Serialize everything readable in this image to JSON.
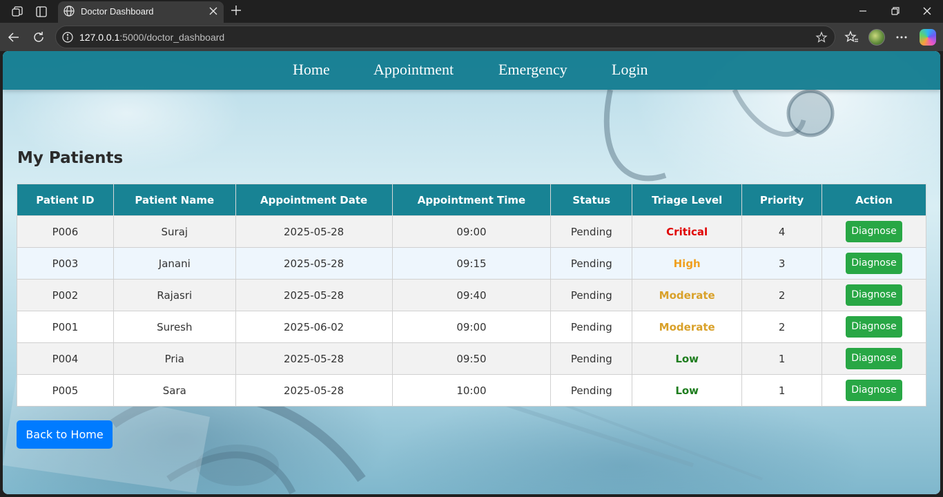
{
  "browser": {
    "tab_title": "Doctor Dashboard",
    "url_host": "127.0.0.1",
    "url_rest": ":5000/doctor_dashboard"
  },
  "nav": {
    "home": "Home",
    "appointment": "Appointment",
    "emergency": "Emergency",
    "login": "Login"
  },
  "page": {
    "title": "My Patients",
    "back_label": "Back to Home"
  },
  "colors": {
    "navbar": "#188394",
    "critical": "#e00000",
    "high": "#f0a020",
    "moderate": "#d9a12a",
    "low": "#1e7d1e",
    "diagnose_button": "#28a745",
    "back_button": "#007bff"
  },
  "table": {
    "headers": [
      "Patient ID",
      "Patient Name",
      "Appointment Date",
      "Appointment Time",
      "Status",
      "Triage Level",
      "Priority",
      "Action"
    ],
    "rows": [
      {
        "id": "P006",
        "name": "Suraj",
        "date": "2025-05-28",
        "time": "09:00",
        "status": "Pending",
        "triage": "Critical",
        "priority": "4",
        "action": "Diagnose"
      },
      {
        "id": "P003",
        "name": "Janani",
        "date": "2025-05-28",
        "time": "09:15",
        "status": "Pending",
        "triage": "High",
        "priority": "3",
        "action": "Diagnose"
      },
      {
        "id": "P002",
        "name": "Rajasri",
        "date": "2025-05-28",
        "time": "09:40",
        "status": "Pending",
        "triage": "Moderate",
        "priority": "2",
        "action": "Diagnose"
      },
      {
        "id": "P001",
        "name": "Suresh",
        "date": "2025-06-02",
        "time": "09:00",
        "status": "Pending",
        "triage": "Moderate",
        "priority": "2",
        "action": "Diagnose"
      },
      {
        "id": "P004",
        "name": "Pria",
        "date": "2025-05-28",
        "time": "09:50",
        "status": "Pending",
        "triage": "Low",
        "priority": "1",
        "action": "Diagnose"
      },
      {
        "id": "P005",
        "name": "Sara",
        "date": "2025-05-28",
        "time": "10:00",
        "status": "Pending",
        "triage": "Low",
        "priority": "1",
        "action": "Diagnose"
      }
    ]
  }
}
